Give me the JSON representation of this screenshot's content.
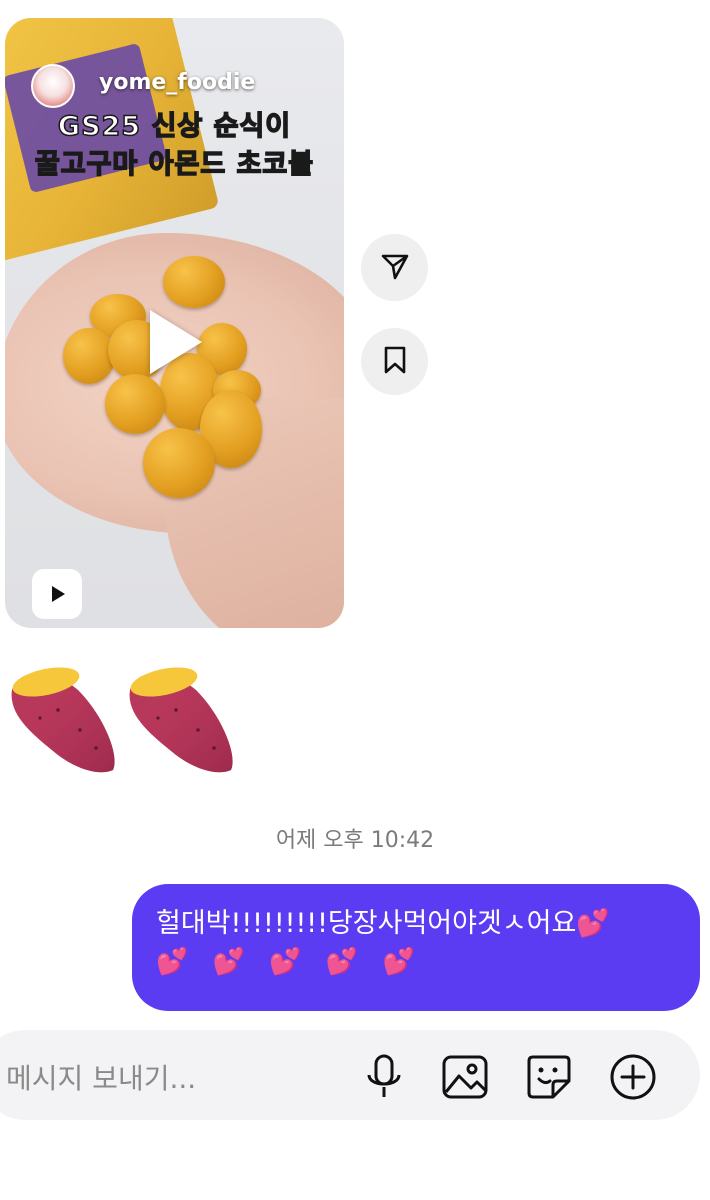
{
  "shared_reel": {
    "username": "yome_foodie",
    "caption_line1": "GS25 신상 순식이",
    "caption_line2": "꿀고구마 아몬드 초코볼"
  },
  "reactions": {
    "emoji_1": "sweet-potato",
    "emoji_2": "sweet-potato"
  },
  "timestamp": "어제 오후 10:42",
  "sent_message": {
    "text": "헐대박!!!!!!!!!당장사먹어야겟ㅅ어요💕",
    "hearts": "💕 💕 💕 💕 💕"
  },
  "composer": {
    "placeholder": "메시지 보내기..."
  },
  "colors": {
    "bubble": "#5b3cf2",
    "composer_bg": "#f3f3f5"
  },
  "icons": {
    "share": "paper-plane-icon",
    "save": "bookmark-icon",
    "reel_badge": "reels-play-icon",
    "mic": "microphone-icon",
    "gallery": "image-icon",
    "sticker": "sticker-icon",
    "add": "plus-circle-icon"
  }
}
